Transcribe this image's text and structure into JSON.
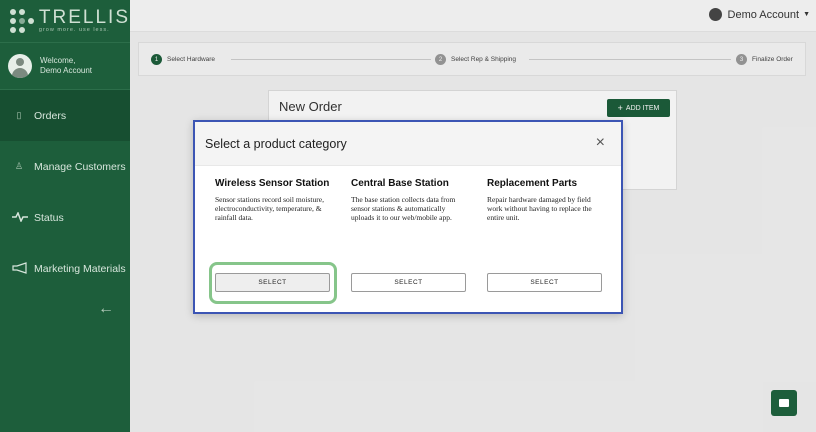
{
  "brand": {
    "name": "TRELLIS",
    "tagline": "grow more. use less."
  },
  "user": {
    "welcome": "Welcome,",
    "name": "Demo Account"
  },
  "sidebar": {
    "items": [
      {
        "label": "Orders",
        "icon": "document-icon",
        "active": true
      },
      {
        "label": "Manage Customers",
        "icon": "person-icon",
        "active": false
      },
      {
        "label": "Status",
        "icon": "pulse-icon",
        "active": false
      },
      {
        "label": "Marketing Materials",
        "icon": "megaphone-icon",
        "active": false
      }
    ],
    "collapse_icon": "arrow-left-icon"
  },
  "topbar": {
    "account_label": "Demo Account"
  },
  "stepper": {
    "steps": [
      {
        "num": "1",
        "label": "Select Hardware",
        "active": true
      },
      {
        "num": "2",
        "label": "Select Rep & Shipping",
        "active": false
      },
      {
        "num": "3",
        "label": "Finalize Order",
        "active": false
      }
    ]
  },
  "order": {
    "title": "New Order",
    "add_item_label": "ADD ITEM"
  },
  "modal": {
    "title": "Select a product category",
    "close": "×",
    "categories": [
      {
        "title": "Wireless Sensor Station",
        "description": "Sensor stations record soil moisture, electroconductivity, temperature, & rainfall data.",
        "button": "SELECT"
      },
      {
        "title": "Central Base Station",
        "description": "The base station collects data from sensor stations & automatically uploads it to our web/mobile app.",
        "button": "SELECT"
      },
      {
        "title": "Replacement Parts",
        "description": "Repair hardware damaged by field work without having to replace the entire unit.",
        "button": "SELECT"
      }
    ]
  },
  "colors": {
    "brand_green": "#1d5e3b",
    "modal_border": "#3c55b4",
    "highlight": "#86c58a"
  }
}
